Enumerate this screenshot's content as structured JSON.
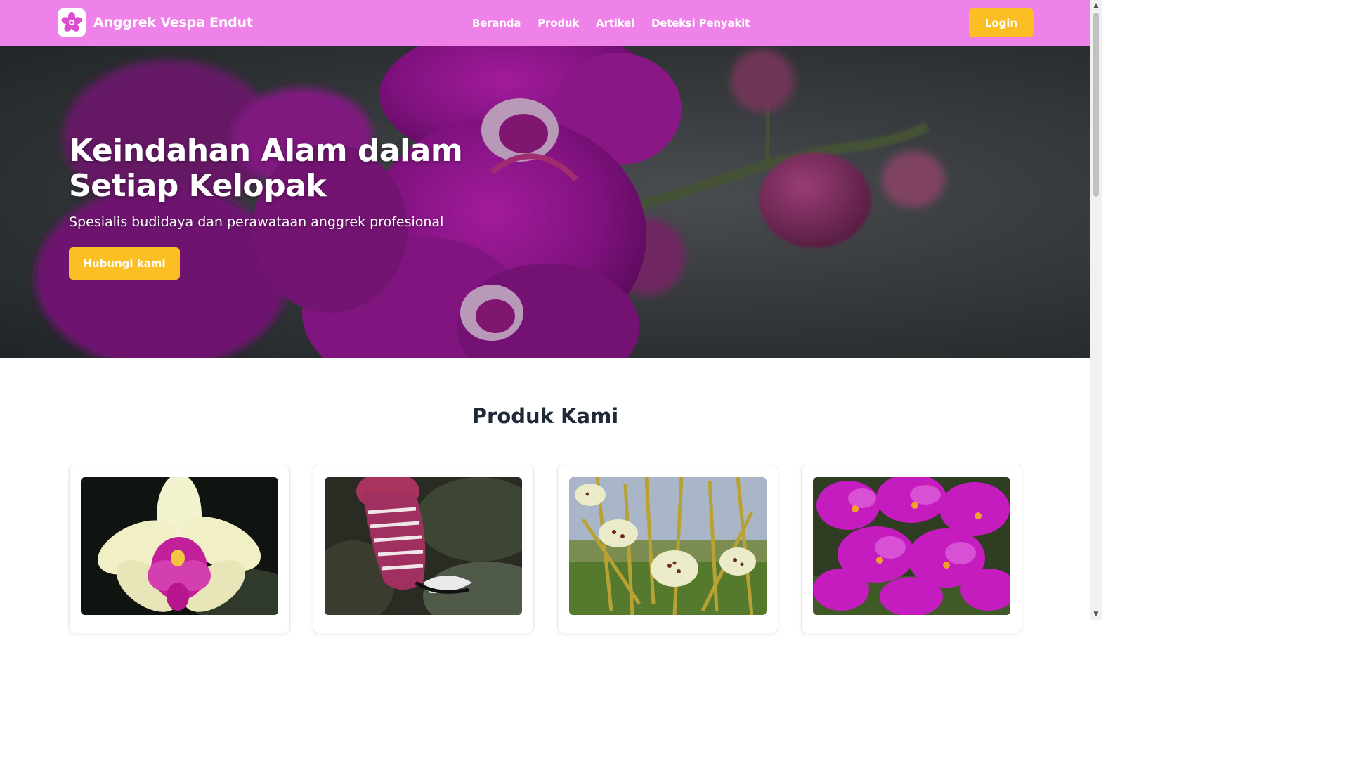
{
  "navbar": {
    "brand_name": "Anggrek Vespa Endut",
    "links": [
      "Beranda",
      "Produk",
      "Artikel",
      "Deteksi Penyakit"
    ],
    "login_label": "Login",
    "logo_icon": "orchid-logo-icon",
    "background_color": "#ee82e8"
  },
  "hero": {
    "title": "Keindahan Alam dalam Setiap Kelopak",
    "subtitle": "Spesialis budidaya dan perawataan anggrek profesional",
    "cta_label": "Hubungi kami",
    "accent_color": "#fbbf24"
  },
  "products": {
    "title": "Produk Kami",
    "cards": [
      {
        "image_icon": "white-pink-orchid-image"
      },
      {
        "image_icon": "slipper-orchid-image"
      },
      {
        "image_icon": "spider-orchid-image"
      },
      {
        "image_icon": "purple-orchid-cluster-image"
      }
    ]
  }
}
